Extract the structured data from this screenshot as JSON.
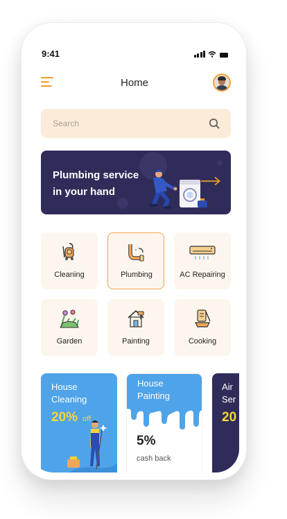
{
  "status_bar": {
    "time": "9:41"
  },
  "header": {
    "title": "Home"
  },
  "search": {
    "placeholder": "Search"
  },
  "banner": {
    "line1": "Plumbing service",
    "line2": "in your hand"
  },
  "categories": [
    {
      "label": "Cleaning",
      "icon": "vacuum-cleaner-icon"
    },
    {
      "label": "Plumbing",
      "icon": "pipe-icon",
      "selected": true
    },
    {
      "label": "AC Repairing",
      "icon": "air-conditioner-icon"
    },
    {
      "label": "Garden",
      "icon": "flower-plant-icon"
    },
    {
      "label": "Painting",
      "icon": "house-paint-icon"
    },
    {
      "label": "Cooking",
      "icon": "cooking-icon"
    }
  ],
  "promos": [
    {
      "title_line1": "House",
      "title_line2": "Cleaning",
      "value": "20%",
      "suffix": "off",
      "color": "#4fa3e8"
    },
    {
      "title_line1": "House",
      "title_line2": "Painting",
      "value": "5%",
      "suffix": "cash back",
      "color": "#4fa3e8"
    },
    {
      "title_line1": "Air",
      "title_line2": "Ser",
      "value": "20",
      "color": "#302c5a"
    }
  ],
  "colors": {
    "accent": "#f39a2b",
    "search_bg": "#fdebd9",
    "banner_bg": "#302c5a",
    "promo_yellow": "#f7d634"
  }
}
